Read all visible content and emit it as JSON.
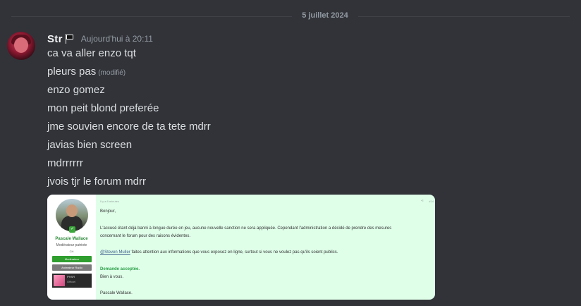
{
  "divider": {
    "date": "5 juillet 2024"
  },
  "message": {
    "username": "Str",
    "timestamp": "Aujourd'hui à 20:11",
    "edited_label": "(modifié)",
    "lines": [
      "ca va aller enzo tqt",
      "pleurs pas",
      "enzo gomez",
      "mon peit blond preferée",
      "jme souvien encore de ta tete mdrr",
      "javias bien screen",
      "mdrrrrrr",
      "jvois tjr le forum mdrr"
    ]
  },
  "embed": {
    "meta": "Il y a 8 minutes",
    "post_number": "#14",
    "sidebar": {
      "name": "Pascale Wallace",
      "role": "Modérateur patriote",
      "sub": "CH",
      "chip1": "Modérateur",
      "chip2": "Animateur Radio",
      "phsr_title": "PHSR",
      "phsr_sub": "Officiel"
    },
    "greeting": "Bonjour,",
    "para1": "L'accusé étant déjà banni à longue durée en jeu, aucune nouvelle sanction ne sera appliquée. Cependant l'administration a décidé de prendre des mesures",
    "para1b": "concernant le forum pour des raisons évidentes.",
    "mention": "@Steven Muller",
    "para2": " faites attention aux informations que vous exposez en ligne, surtout si vous ne voulez pas qu'ils soient publics.",
    "status": "Demande acceptée.",
    "closing": "Bien à vous.",
    "signature": "Pascale Wallace."
  }
}
